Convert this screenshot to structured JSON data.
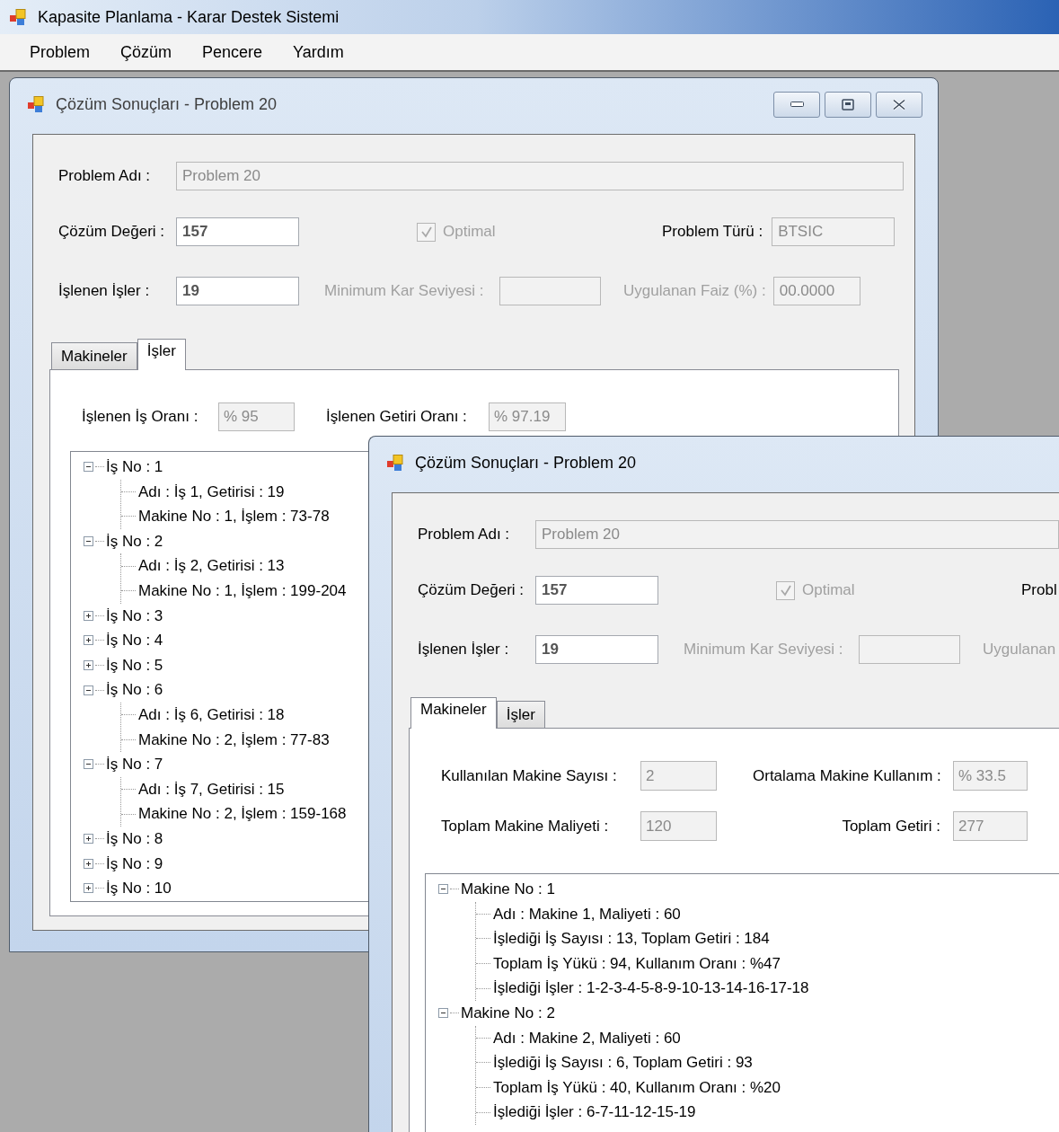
{
  "app": {
    "title": "Kapasite Planlama - Karar Destek Sistemi"
  },
  "menu": [
    "Problem",
    "Çözüm",
    "Pencere",
    "Yardım"
  ],
  "windows": [
    {
      "title": "Çözüm Sonuçları - Problem 20",
      "active": false,
      "title_buttons": [
        {
          "kind": "minimize"
        },
        {
          "kind": "restore"
        },
        {
          "kind": "close"
        }
      ],
      "form": {
        "problem_name": {
          "label": "Problem Adı :",
          "field": {
            "value": "Problem 20",
            "disabled": true
          }
        },
        "solution_value": {
          "label": "Çözüm Değeri :",
          "field": {
            "value": "157",
            "disabled": false
          }
        },
        "optimal": {
          "label": "Optimal",
          "checked": true,
          "disabled": true
        },
        "problem_type": {
          "label": "Problem Türü :",
          "field": {
            "value": "BTSIC",
            "disabled": true
          }
        },
        "processed_jobs": {
          "label": "İşlenen İşler :",
          "field": {
            "value": "19",
            "disabled": false
          }
        },
        "min_profit": {
          "label": "Minimum Kar Seviyesi :",
          "disabled": true,
          "field": {
            "disabled": true
          }
        },
        "interest": {
          "label": "Uygulanan Faiz (%) :",
          "disabled": true,
          "field": {
            "value": "00.0000",
            "disabled": true
          }
        }
      },
      "tabs": [
        {
          "label": "Makineler",
          "selected": false
        },
        {
          "label": "İşler",
          "selected": true
        }
      ],
      "tab_page": {
        "kind": "jobs",
        "stats": [
          [
            {
              "label": "İşlenen İş Oranı :",
              "value": "% 95"
            },
            {
              "label": "İşlenen Getiri Oranı :",
              "value": "% 97.19"
            }
          ]
        ],
        "tree": [
          {
            "label": "İş No : 1",
            "expanded": true,
            "children": [
              "Adı : İş 1, Getirisi : 19",
              "Makine No : 1, İşlem : 73-78"
            ]
          },
          {
            "label": "İş No : 2",
            "expanded": true,
            "children": [
              "Adı : İş 2, Getirisi : 13",
              "Makine No : 1, İşlem : 199-204"
            ]
          },
          {
            "label": "İş No : 3",
            "expanded": false
          },
          {
            "label": "İş No : 4",
            "expanded": false
          },
          {
            "label": "İş No : 5",
            "expanded": false
          },
          {
            "label": "İş No : 6",
            "expanded": true,
            "children": [
              "Adı : İş 6, Getirisi : 18",
              "Makine No : 2, İşlem : 77-83"
            ]
          },
          {
            "label": "İş No : 7",
            "expanded": true,
            "children": [
              "Adı : İş 7, Getirisi : 15",
              "Makine No : 2, İşlem : 159-168"
            ]
          },
          {
            "label": "İş No : 8",
            "expanded": false
          },
          {
            "label": "İş No : 9",
            "expanded": false
          },
          {
            "label": "İş No : 10",
            "expanded": false
          }
        ]
      }
    },
    {
      "title": "Çözüm Sonuçları - Problem 20",
      "active": true,
      "form": {
        "problem_name": {
          "label": "Problem Adı :",
          "field": {
            "value": "Problem 20",
            "disabled": true
          }
        },
        "solution_value": {
          "label": "Çözüm Değeri :",
          "field": {
            "value": "157",
            "disabled": false
          }
        },
        "optimal": {
          "label": "Optimal",
          "checked": true,
          "disabled": true
        },
        "problem_type": {
          "label": "Probl"
        },
        "processed_jobs": {
          "label": "İşlenen İşler :",
          "field": {
            "value": "19",
            "disabled": false
          }
        },
        "min_profit": {
          "label": "Minimum Kar Seviyesi :",
          "disabled": true,
          "field": {
            "disabled": true
          }
        },
        "interest": {
          "label": "Uygulanan",
          "disabled": true
        }
      },
      "tabs": [
        {
          "label": "Makineler",
          "selected": true
        },
        {
          "label": "İşler",
          "selected": false
        }
      ],
      "tab_page": {
        "kind": "machines",
        "stats": [
          [
            {
              "label": "Kullanılan Makine Sayısı :",
              "value": "2"
            },
            {
              "label": "Ortalama Makine Kullanım :",
              "value": "% 33.5"
            }
          ],
          [
            {
              "label": "Toplam Makine Maliyeti :",
              "value": "120"
            },
            {
              "label": "Toplam Getiri :",
              "value": "277"
            }
          ]
        ],
        "tree": [
          {
            "label": "Makine No : 1",
            "expanded": true,
            "children": [
              "Adı : Makine 1, Maliyeti : 60",
              "İşlediği İş Sayısı : 13, Toplam Getiri : 184",
              "Toplam İş Yükü : 94, Kullanım Oranı : %47",
              "İşlediği İşler : 1-2-3-4-5-8-9-10-13-14-16-17-18"
            ]
          },
          {
            "label": "Makine No : 2",
            "expanded": true,
            "children": [
              "Adı : Makine 2, Maliyeti : 60",
              "İşlediği İş Sayısı : 6, Toplam Getiri : 93",
              "Toplam İş Yükü : 40, Kullanım Oranı : %20",
              "İşlediği İşler : 6-7-11-12-15-19"
            ]
          }
        ]
      }
    }
  ]
}
